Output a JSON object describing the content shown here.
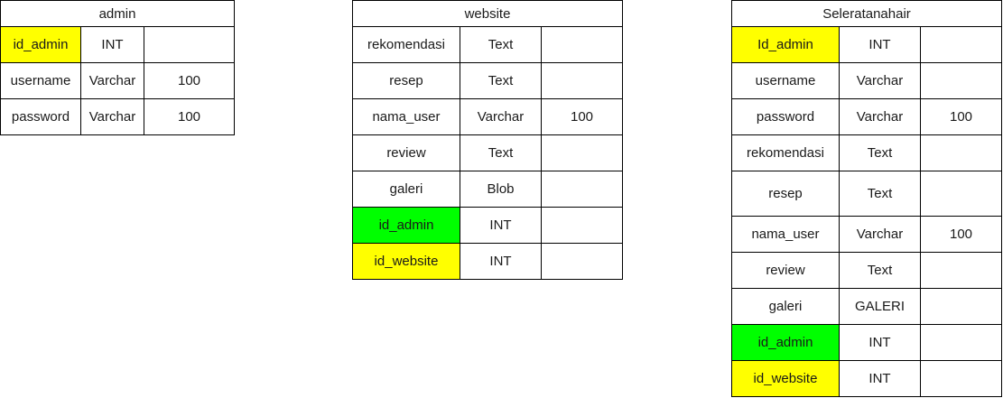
{
  "colors": {
    "primary_key": "#ffff00",
    "foreign_key": "#00ff00"
  },
  "tables": {
    "admin": {
      "title": "admin",
      "rows": [
        {
          "name": "id_admin",
          "type": "INT",
          "size": "",
          "key": "primary"
        },
        {
          "name": "username",
          "type": "Varchar",
          "size": "100",
          "key": ""
        },
        {
          "name": "password",
          "type": "Varchar",
          "size": "100",
          "key": ""
        }
      ]
    },
    "website": {
      "title": "website",
      "rows": [
        {
          "name": "rekomendasi",
          "type": "Text",
          "size": "",
          "key": ""
        },
        {
          "name": "resep",
          "type": "Text",
          "size": "",
          "key": ""
        },
        {
          "name": "nama_user",
          "type": "Varchar",
          "size": "100",
          "key": ""
        },
        {
          "name": "review",
          "type": "Text",
          "size": "",
          "key": ""
        },
        {
          "name": "galeri",
          "type": "Blob",
          "size": "",
          "key": ""
        },
        {
          "name": "id_admin",
          "type": "INT",
          "size": "",
          "key": "foreign"
        },
        {
          "name": "id_website",
          "type": "INT",
          "size": "",
          "key": "primary"
        }
      ]
    },
    "seleratanahair": {
      "title": "Seleratanahair",
      "rows": [
        {
          "name": "Id_admin",
          "type": "INT",
          "size": "",
          "key": "primary"
        },
        {
          "name": "username",
          "type": "Varchar",
          "size": "",
          "key": ""
        },
        {
          "name": "password",
          "type": "Varchar",
          "size": "100",
          "key": ""
        },
        {
          "name": "rekomendasi",
          "type": "Text",
          "size": "",
          "key": ""
        },
        {
          "name": "resep",
          "type": "Text",
          "size": "",
          "key": ""
        },
        {
          "name": "nama_user",
          "type": "Varchar",
          "size": "100",
          "key": ""
        },
        {
          "name": "review",
          "type": "Text",
          "size": "",
          "key": ""
        },
        {
          "name": "galeri",
          "type": "GALERI",
          "size": "",
          "key": ""
        },
        {
          "name": "id_admin",
          "type": "INT",
          "size": "",
          "key": "foreign"
        },
        {
          "name": "id_website",
          "type": "INT",
          "size": "",
          "key": "primary"
        }
      ]
    }
  }
}
